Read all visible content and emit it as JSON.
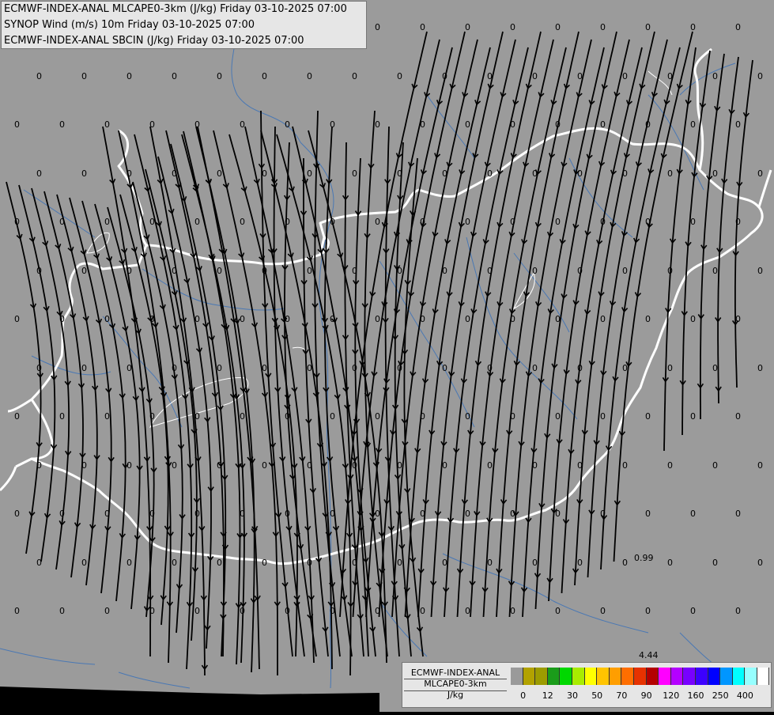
{
  "header": {
    "line1": "ECMWF-INDEX-ANAL MLCAPE0-3km (J/kg) Friday 03-10-2025 07:00",
    "line2": "SYNOP Wind (m/s) 10m Friday 03-10-2025 07:00",
    "line3": "ECMWF-INDEX-ANAL SBCIN (J/kg) Friday 03-10-2025 07:00"
  },
  "legend": {
    "title1": "ECMWF-INDEX-ANAL",
    "title2": "MLCAPE0-3km",
    "unit": "J/kg",
    "colors": [
      "#9a9a9a",
      "#b2a200",
      "#9c9c00",
      "#1a9c1a",
      "#00d800",
      "#a8ec00",
      "#ffff00",
      "#ffc400",
      "#ff9e00",
      "#ff6e00",
      "#e63200",
      "#b40000",
      "#ff00ff",
      "#b400ff",
      "#7800ff",
      "#3c00ff",
      "#0000ff",
      "#0096ff",
      "#00ffff",
      "#96ffff",
      "#ffffff"
    ],
    "ticks": [
      "0",
      "12",
      "30",
      "50",
      "70",
      "90",
      "120",
      "160",
      "250",
      "400"
    ]
  },
  "map": {
    "background": "#9b9b9b",
    "border_color": "#ffffff",
    "river_color": "#4a78b4",
    "streamline_color": "#000000",
    "value_label": "0",
    "special_labels": [
      "0.99",
      "4.44"
    ]
  }
}
